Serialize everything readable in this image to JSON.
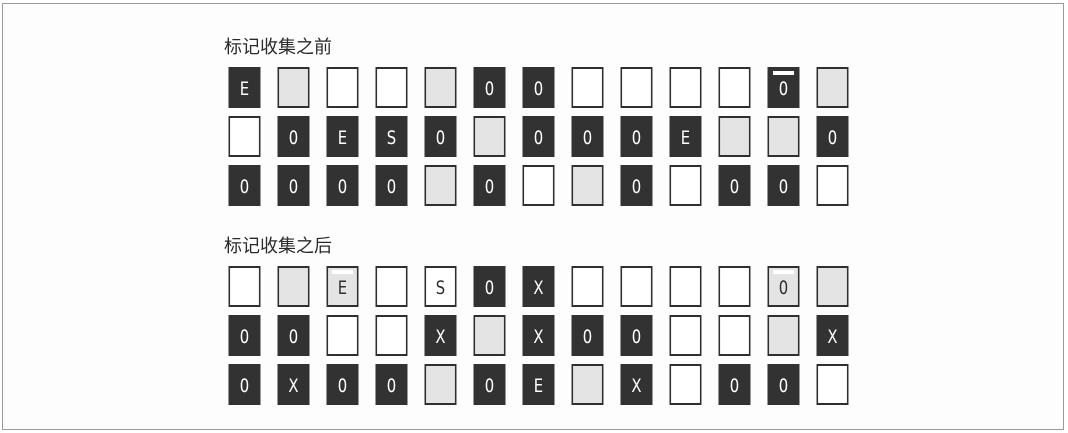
{
  "sections": [
    {
      "title": "标记收集之前",
      "rows": [
        [
          {
            "label": "E",
            "style": "dark"
          },
          {
            "label": "",
            "style": "gray"
          },
          {
            "label": "",
            "style": "white"
          },
          {
            "label": "",
            "style": "white"
          },
          {
            "label": "",
            "style": "gray"
          },
          {
            "label": "0",
            "style": "dark"
          },
          {
            "label": "0",
            "style": "dark"
          },
          {
            "label": "",
            "style": "white"
          },
          {
            "label": "",
            "style": "white"
          },
          {
            "label": "",
            "style": "white"
          },
          {
            "label": "",
            "style": "white"
          },
          {
            "label": "0",
            "style": "dark",
            "marked": true
          },
          {
            "label": "",
            "style": "gray"
          }
        ],
        [
          {
            "label": "",
            "style": "white"
          },
          {
            "label": "0",
            "style": "dark"
          },
          {
            "label": "E",
            "style": "dark"
          },
          {
            "label": "S",
            "style": "dark"
          },
          {
            "label": "0",
            "style": "dark"
          },
          {
            "label": "",
            "style": "gray"
          },
          {
            "label": "0",
            "style": "dark"
          },
          {
            "label": "0",
            "style": "dark"
          },
          {
            "label": "0",
            "style": "dark"
          },
          {
            "label": "E",
            "style": "dark"
          },
          {
            "label": "",
            "style": "gray"
          },
          {
            "label": "",
            "style": "gray"
          },
          {
            "label": "0",
            "style": "dark"
          }
        ],
        [
          {
            "label": "0",
            "style": "dark"
          },
          {
            "label": "0",
            "style": "dark"
          },
          {
            "label": "0",
            "style": "dark"
          },
          {
            "label": "0",
            "style": "dark"
          },
          {
            "label": "",
            "style": "gray"
          },
          {
            "label": "0",
            "style": "dark"
          },
          {
            "label": "",
            "style": "white"
          },
          {
            "label": "",
            "style": "gray"
          },
          {
            "label": "0",
            "style": "dark"
          },
          {
            "label": "",
            "style": "white"
          },
          {
            "label": "0",
            "style": "dark"
          },
          {
            "label": "0",
            "style": "dark"
          },
          {
            "label": "",
            "style": "white"
          }
        ]
      ]
    },
    {
      "title": "标记收集之后",
      "rows": [
        [
          {
            "label": "",
            "style": "white"
          },
          {
            "label": "",
            "style": "gray"
          },
          {
            "label": "E",
            "style": "gray",
            "marked": true
          },
          {
            "label": "",
            "style": "white"
          },
          {
            "label": "S",
            "style": "white",
            "marked": true
          },
          {
            "label": "0",
            "style": "dark"
          },
          {
            "label": "X",
            "style": "dark"
          },
          {
            "label": "",
            "style": "white"
          },
          {
            "label": "",
            "style": "white"
          },
          {
            "label": "",
            "style": "white"
          },
          {
            "label": "",
            "style": "white"
          },
          {
            "label": "0",
            "style": "gray",
            "marked": true
          },
          {
            "label": "",
            "style": "gray"
          }
        ],
        [
          {
            "label": "0",
            "style": "dark"
          },
          {
            "label": "0",
            "style": "dark"
          },
          {
            "label": "",
            "style": "white"
          },
          {
            "label": "",
            "style": "white"
          },
          {
            "label": "X",
            "style": "dark"
          },
          {
            "label": "",
            "style": "gray"
          },
          {
            "label": "X",
            "style": "dark"
          },
          {
            "label": "0",
            "style": "dark"
          },
          {
            "label": "0",
            "style": "dark"
          },
          {
            "label": "",
            "style": "white"
          },
          {
            "label": "",
            "style": "white"
          },
          {
            "label": "",
            "style": "gray"
          },
          {
            "label": "X",
            "style": "dark"
          }
        ],
        [
          {
            "label": "0",
            "style": "dark"
          },
          {
            "label": "X",
            "style": "dark"
          },
          {
            "label": "0",
            "style": "dark"
          },
          {
            "label": "0",
            "style": "dark"
          },
          {
            "label": "",
            "style": "gray"
          },
          {
            "label": "0",
            "style": "dark"
          },
          {
            "label": "E",
            "style": "dark"
          },
          {
            "label": "",
            "style": "gray"
          },
          {
            "label": "X",
            "style": "dark"
          },
          {
            "label": "",
            "style": "white"
          },
          {
            "label": "0",
            "style": "dark"
          },
          {
            "label": "0",
            "style": "dark"
          },
          {
            "label": "",
            "style": "white"
          }
        ]
      ]
    }
  ]
}
